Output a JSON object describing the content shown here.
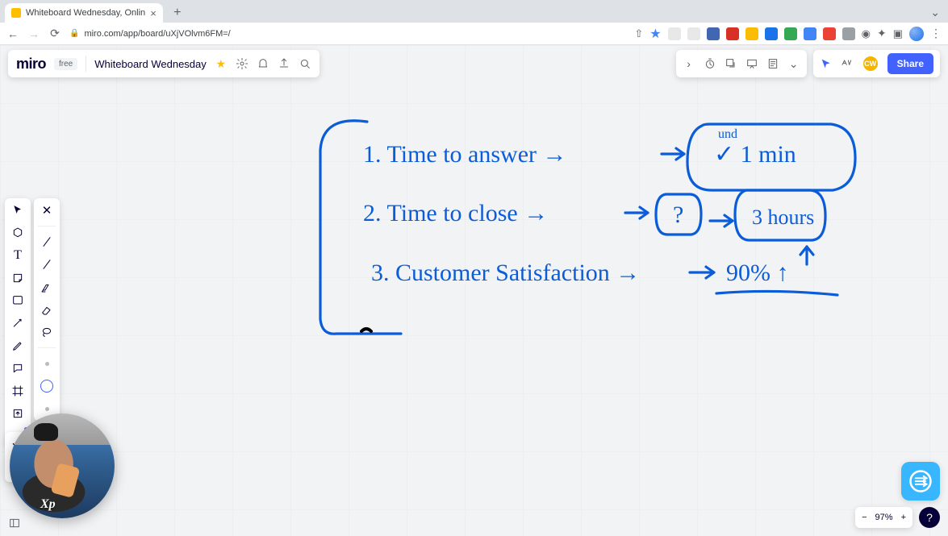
{
  "browser": {
    "tab_title": "Whiteboard Wednesday, Onlin",
    "url": "miro.com/app/board/uXjVOlvm6FM=/"
  },
  "miro": {
    "logo": "miro",
    "plan_badge": "free",
    "board_name": "Whiteboard Wednesday",
    "share_label": "Share",
    "user_initials": "CW"
  },
  "handwriting": {
    "line1": "1. Time to answer →",
    "line1_badge_top": "und",
    "line1_badge": "✓ 1 min",
    "line2": "2. Time to close →",
    "line2_box1": "?",
    "line2_arrow": "→",
    "line2_box2": "3 hours",
    "line3": "3. Customer Satisfaction →",
    "line3_value": "90% ↑"
  },
  "zoom": {
    "minus": "−",
    "value": "97%",
    "plus": "+"
  },
  "webcam": {
    "logo": "Xp"
  },
  "help": "?"
}
